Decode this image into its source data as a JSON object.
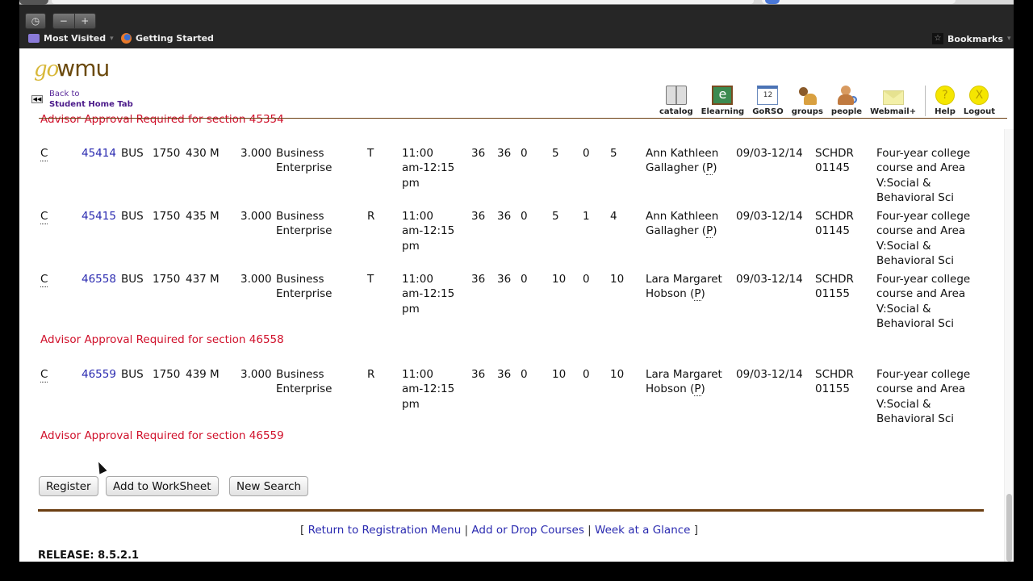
{
  "browser": {
    "toolbar": {
      "history_icon": "clock-icon",
      "zoom_out": "−",
      "zoom_in": "+"
    },
    "bookmarks_bar": {
      "items": [
        {
          "label": "Most Visited",
          "icon": "folder-icon"
        },
        {
          "label": "Getting Started",
          "icon": "firefox-icon"
        }
      ],
      "bookmarks_label": "Bookmarks"
    }
  },
  "header": {
    "logo_prefix": "go",
    "logo_text": "wmu",
    "back": {
      "line1": "Back to",
      "line2": "Student Home Tab",
      "icon": "rewind-icon"
    },
    "nav_icons": [
      {
        "label": "catalog",
        "icon": "book-icon"
      },
      {
        "label": "Elearning",
        "icon": "chalkboard-icon",
        "glyph": "e"
      },
      {
        "label": "GoRSO",
        "icon": "calendar-icon",
        "glyph": "12"
      },
      {
        "label": "groups",
        "icon": "groups-icon"
      },
      {
        "label": "people",
        "icon": "people-search-icon"
      },
      {
        "label": "Webmail+",
        "icon": "envelope-icon"
      },
      {
        "label": "Help",
        "icon": "help-icon",
        "glyph": "?"
      },
      {
        "label": "Logout",
        "icon": "logout-icon",
        "glyph": "X"
      }
    ]
  },
  "warnings": {
    "top": "Advisor Approval Required for section 45354",
    "w46558": "Advisor Approval Required for section 46558",
    "w46559": "Advisor Approval Required for section 46559"
  },
  "sections": [
    {
      "status": "C",
      "crn": "45414",
      "subj": "BUS",
      "crse": "1750",
      "sec": "430",
      "cmp": "M",
      "cred": "3.000",
      "title": "Business\nEnterprise",
      "days": "T",
      "time": "11:00\nam-12:15\npm",
      "cap": "36",
      "act": "36",
      "rem": "0",
      "wl_cap": "5",
      "wl_act": "0",
      "wl_rem": "5",
      "instructor": "Ann Kathleen\nGallagher (",
      "instr_p": "P",
      "date": "09/03-12/14",
      "location": "SCHDR\n01145",
      "attribute": "Four-year college\ncourse and Area\nV:Social &\nBehavioral Sci"
    },
    {
      "status": "C",
      "crn": "45415",
      "subj": "BUS",
      "crse": "1750",
      "sec": "435",
      "cmp": "M",
      "cred": "3.000",
      "title": "Business\nEnterprise",
      "days": "R",
      "time": "11:00\nam-12:15\npm",
      "cap": "36",
      "act": "36",
      "rem": "0",
      "wl_cap": "5",
      "wl_act": "1",
      "wl_rem": "4",
      "instructor": "Ann Kathleen\nGallagher (",
      "instr_p": "P",
      "date": "09/03-12/14",
      "location": "SCHDR\n01145",
      "attribute": "Four-year college\ncourse and Area\nV:Social &\nBehavioral Sci"
    },
    {
      "status": "C",
      "crn": "46558",
      "subj": "BUS",
      "crse": "1750",
      "sec": "437",
      "cmp": "M",
      "cred": "3.000",
      "title": "Business\nEnterprise",
      "days": "T",
      "time": "11:00\nam-12:15\npm",
      "cap": "36",
      "act": "36",
      "rem": "0",
      "wl_cap": "10",
      "wl_act": "0",
      "wl_rem": "10",
      "instructor": "Lara Margaret\nHobson (",
      "instr_p": "P",
      "date": "09/03-12/14",
      "location": "SCHDR\n01155",
      "attribute": "Four-year college\ncourse and Area\nV:Social &\nBehavioral Sci"
    },
    {
      "status": "C",
      "crn": "46559",
      "subj": "BUS",
      "crse": "1750",
      "sec": "439",
      "cmp": "M",
      "cred": "3.000",
      "title": "Business\nEnterprise",
      "days": "R",
      "time": "11:00\nam-12:15\npm",
      "cap": "36",
      "act": "36",
      "rem": "0",
      "wl_cap": "10",
      "wl_act": "0",
      "wl_rem": "10",
      "instructor": "Lara Margaret\nHobson (",
      "instr_p": "P",
      "date": "09/03-12/14",
      "location": "SCHDR\n01155",
      "attribute": "Four-year college\ncourse and Area\nV:Social &\nBehavioral Sci"
    }
  ],
  "actions": {
    "register": "Register",
    "add_worksheet": "Add to WorkSheet",
    "new_search": "New Search"
  },
  "footer": {
    "open": "[ ",
    "links": [
      "Return to Registration Menu",
      "Add or Drop Courses",
      "Week at a Glance"
    ],
    "sep": " | ",
    "close": " ]",
    "release": "RELEASE: 8.5.2.1"
  },
  "colors": {
    "warning": "#d0112b",
    "link": "#2a2ab0",
    "rule": "#6b3e12"
  }
}
